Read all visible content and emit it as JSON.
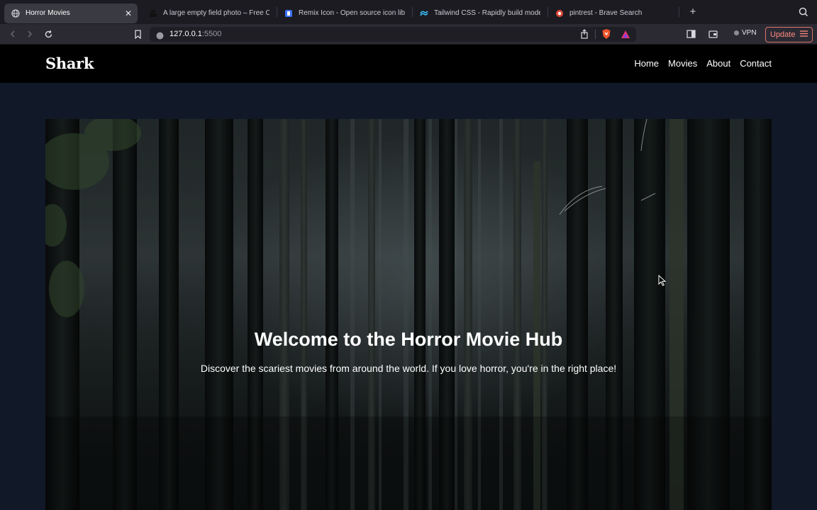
{
  "browser": {
    "tabs": [
      {
        "title": "Horror Movies",
        "icon": "globe-icon",
        "active": true
      },
      {
        "title": "A large empty field photo – Free C",
        "icon": "unsplash-icon",
        "active": false
      },
      {
        "title": "Remix Icon - Open source icon lib",
        "icon": "remix-icon",
        "active": false
      },
      {
        "title": "Tailwind CSS - Rapidly build mode",
        "icon": "tailwind-icon",
        "active": false
      },
      {
        "title": "pintrest - Brave Search",
        "icon": "brave-search-icon",
        "active": false
      }
    ],
    "new_tab_label": "+",
    "url_host": "127.0.0.1",
    "url_port": ":5500",
    "vpn_label": "VPN",
    "update_label": "Update",
    "colors": {
      "tabstrip": "#1c1b22",
      "toolbar": "#2b2a33",
      "update_accent": "#ff8a80"
    }
  },
  "site": {
    "brand": "Shark",
    "nav": [
      "Home",
      "Movies",
      "About",
      "Contact"
    ],
    "hero": {
      "title": "Welcome to the Horror Movie Hub",
      "subtitle": "Discover the scariest movies from around the world. If you love horror, you're in the right place!"
    },
    "colors": {
      "page_bg": "#111827",
      "nav_bg": "#000000",
      "text": "#ffffff"
    }
  }
}
